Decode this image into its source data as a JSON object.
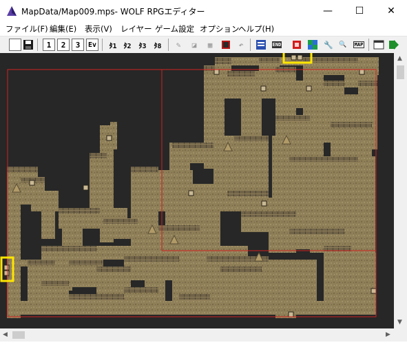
{
  "window": {
    "title": "MapData/Map009.mps- WOLF RPGエディター",
    "minimize_glyph": "—",
    "maximize_glyph": "☐",
    "close_glyph": "✕"
  },
  "menu": [
    {
      "label": "ファイル(F)"
    },
    {
      "label": "編集(E)"
    },
    {
      "label": "表示(V)"
    },
    {
      "label": "レイヤー"
    },
    {
      "label": "ゲーム設定"
    },
    {
      "label": "オプション"
    },
    {
      "label": "ヘルプ(H)"
    }
  ],
  "toolbar": {
    "layer_1": "1",
    "layer_2": "2",
    "layer_3": "3",
    "ev": "Ev",
    "pen_1": "ﾀ1",
    "pen_2": "ﾀ2",
    "pen_3": "ﾀ3",
    "pen_4": "ﾀ8",
    "end_label": "END",
    "map_label": "MAP"
  },
  "icons": {
    "app": "wolf-editor-icon",
    "new": "new-file-icon",
    "save": "save-icon"
  },
  "colors": {
    "canvas_bg": "#272727",
    "floor": "#8f7f58",
    "wall": "#6e6247",
    "grid_line": "#d22020",
    "highlight": "#ffe600"
  }
}
